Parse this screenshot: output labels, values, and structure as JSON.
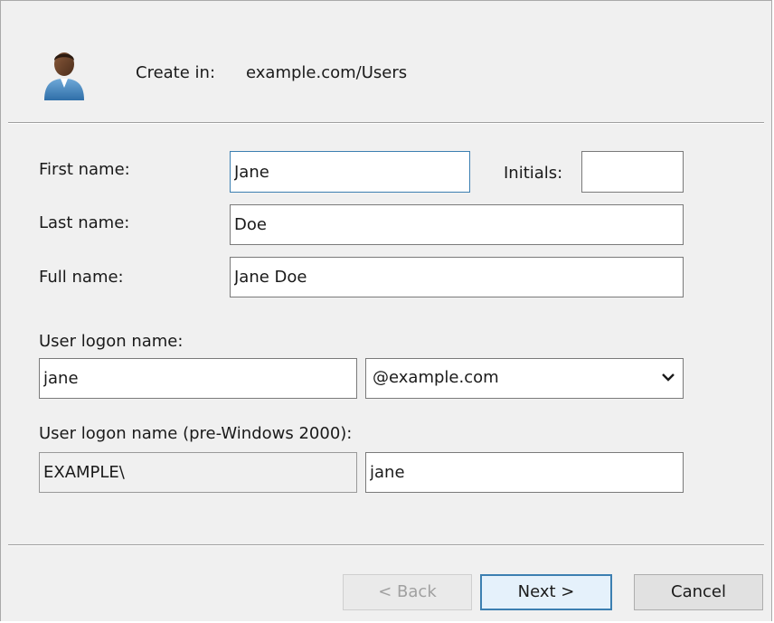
{
  "header": {
    "create_in_label": "Create in:",
    "create_in_value": "example.com/Users",
    "icon": "user-icon"
  },
  "form": {
    "first_name": {
      "label": "First name:",
      "value": "Jane"
    },
    "initials": {
      "label": "Initials:",
      "value": ""
    },
    "last_name": {
      "label": "Last name:",
      "value": "Doe"
    },
    "full_name": {
      "label": "Full name:",
      "value": "Jane Doe"
    },
    "logon_name": {
      "label": "User logon name:",
      "value": "jane",
      "domain_selected": "@example.com"
    },
    "pre_win2000": {
      "label": "User logon name (pre-Windows 2000):",
      "domain_prefix": "EXAMPLE\\",
      "value": "jane"
    }
  },
  "buttons": {
    "back": "< Back",
    "next": "Next >",
    "cancel": "Cancel"
  },
  "colors": {
    "dialog_bg": "#f0f0f0",
    "focus_border": "#3c7fb1",
    "default_button_bg": "#e5f1fb"
  }
}
